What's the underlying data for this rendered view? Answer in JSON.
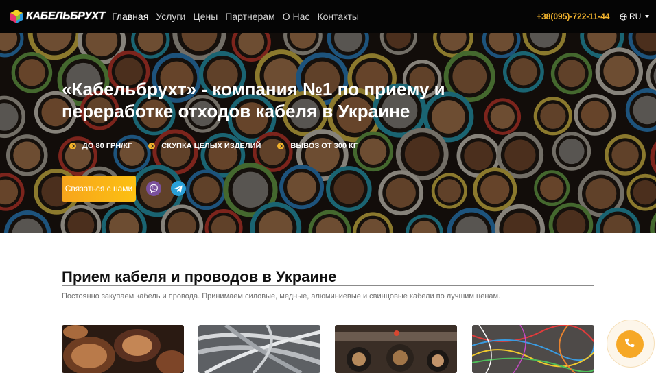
{
  "brand": {
    "name": "КАБЕЛЬБРУХТ",
    "logo_icon": "cube-logo-icon"
  },
  "nav": {
    "items": [
      {
        "label": "Главная",
        "active": true
      },
      {
        "label": "Услуги",
        "active": false
      },
      {
        "label": "Цены",
        "active": false
      },
      {
        "label": "Партнерам",
        "active": false
      },
      {
        "label": "О Нас",
        "active": false
      },
      {
        "label": "Контакты",
        "active": false
      }
    ],
    "phone": "+38(095)-722-11-44",
    "language": "RU",
    "language_icon": "globe-icon"
  },
  "hero": {
    "title": "«Кабельбрухт» - компания №1 по приему и переработке отходов кабеля в Украине",
    "features": [
      {
        "text": "до 80 грн/кг",
        "icon": "arrow-right-circle-icon"
      },
      {
        "text": "Скупка целых изделий",
        "icon": "arrow-right-circle-icon"
      },
      {
        "text": "Вывоз от 300 кг",
        "icon": "arrow-right-circle-icon"
      }
    ],
    "cta_label": "Связаться с нами",
    "messengers": [
      "viber-icon",
      "telegram-icon"
    ]
  },
  "section": {
    "title": "Прием кабеля и проводов в Украине",
    "description": "Постоянно закупаем кабель и провода. Принимаем силовые, медные, алюминиевые и свинцовые кабели по лучшим ценам.",
    "cards": [
      {
        "image": "copper-cable-photo"
      },
      {
        "image": "aluminium-wire-photo"
      },
      {
        "image": "power-cable-photo"
      },
      {
        "image": "colored-wires-photo"
      }
    ]
  },
  "floating_call": {
    "icon": "phone-icon"
  },
  "colors": {
    "navbar_bg": "#050505",
    "accent_orange": "#f6a826",
    "phone_yellow": "#f4b52e",
    "viber": "#7b519d",
    "telegram": "#2aa0d8"
  }
}
